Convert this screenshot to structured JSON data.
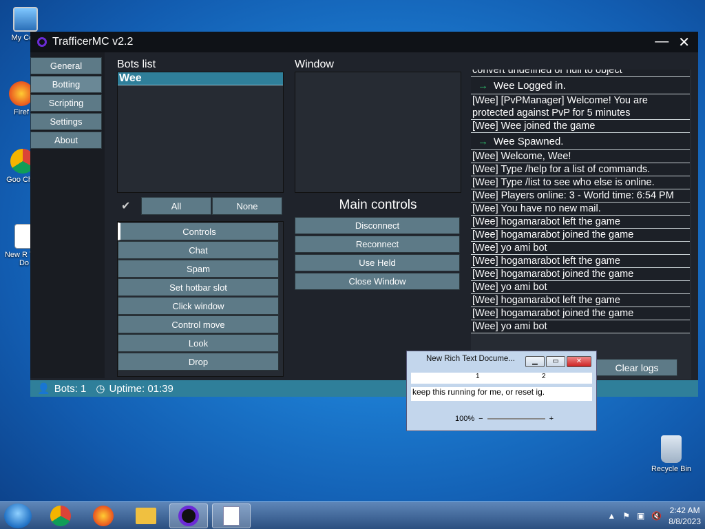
{
  "desktop": {
    "icons": [
      {
        "label": "My Com",
        "icon": "computer-icon"
      },
      {
        "label": "Firef",
        "icon": "firefox-icon"
      },
      {
        "label": "Goo Chro",
        "icon": "chrome-icon"
      },
      {
        "label": "New R Text Do",
        "icon": "document-icon"
      },
      {
        "label": "Recycle Bin",
        "icon": "recycle-bin-icon"
      }
    ]
  },
  "app": {
    "title": "TrafficerMC v2.2",
    "minimize": "—",
    "close": "✕",
    "nav": [
      "General",
      "Botting",
      "Scripting",
      "Settings",
      "About"
    ],
    "bots_list_label": "Bots list",
    "bots": [
      "Wee"
    ],
    "window_label": "Window",
    "all_label": "All",
    "none_label": "None",
    "commands": [
      "Controls",
      "Chat",
      "Spam",
      "Set hotbar slot",
      "Click window",
      "Control move",
      "Look",
      "Drop"
    ],
    "main_controls_label": "Main controls",
    "main_controls": [
      "Disconnect",
      "Reconnect",
      "Use Held",
      "Close Window"
    ],
    "logs": [
      {
        "text": "convert undefined or null to object",
        "type": "text"
      },
      {
        "text": "Wee Logged in.",
        "type": "event",
        "icon": "→"
      },
      {
        "text": "[Wee] [PvPManager] Welcome! You are protected against PvP for 5 minutes",
        "type": "text"
      },
      {
        "text": "[Wee] Wee joined the game",
        "type": "text"
      },
      {
        "text": "Wee Spawned.",
        "type": "event",
        "icon": "→"
      },
      {
        "text": "[Wee] Welcome, Wee!",
        "type": "text"
      },
      {
        "text": "[Wee] Type /help for a list of commands.",
        "type": "text"
      },
      {
        "text": "[Wee] Type /list to see who else is online.",
        "type": "text"
      },
      {
        "text": "[Wee] Players online: 3 - World time: 6:54 PM",
        "type": "text"
      },
      {
        "text": "[Wee] You have no new mail.",
        "type": "text"
      },
      {
        "text": "[Wee] hogamarabot left the game",
        "type": "text"
      },
      {
        "text": "[Wee] hogamarabot joined the game",
        "type": "text"
      },
      {
        "text": "[Wee] yo ami bot",
        "type": "text"
      },
      {
        "text": "[Wee] hogamarabot left the game",
        "type": "text"
      },
      {
        "text": "[Wee] hogamarabot joined the game",
        "type": "text"
      },
      {
        "text": "[Wee] yo ami bot",
        "type": "text"
      },
      {
        "text": "[Wee] hogamarabot left the game",
        "type": "text"
      },
      {
        "text": "[Wee] hogamarabot joined the game",
        "type": "text"
      },
      {
        "text": "[Wee] yo ami bot",
        "type": "text"
      }
    ],
    "clear_logs": "Clear logs",
    "status": {
      "bots": "Bots: 1",
      "uptime": "Uptime: 01:39"
    }
  },
  "wordpad": {
    "title": "New Rich Text Docume...",
    "ruler_marks": [
      "1",
      "2"
    ],
    "text": "keep this running for me, or reset ig.",
    "zoom": "100%",
    "zoom_out": "−",
    "zoom_in": "+"
  },
  "taskbar": {
    "apps": [
      "chrome-icon",
      "firefox-icon",
      "explorer-icon",
      "trafficermc-icon",
      "wordpad-icon"
    ],
    "time": "2:42 AM",
    "date": "8/8/2023"
  }
}
